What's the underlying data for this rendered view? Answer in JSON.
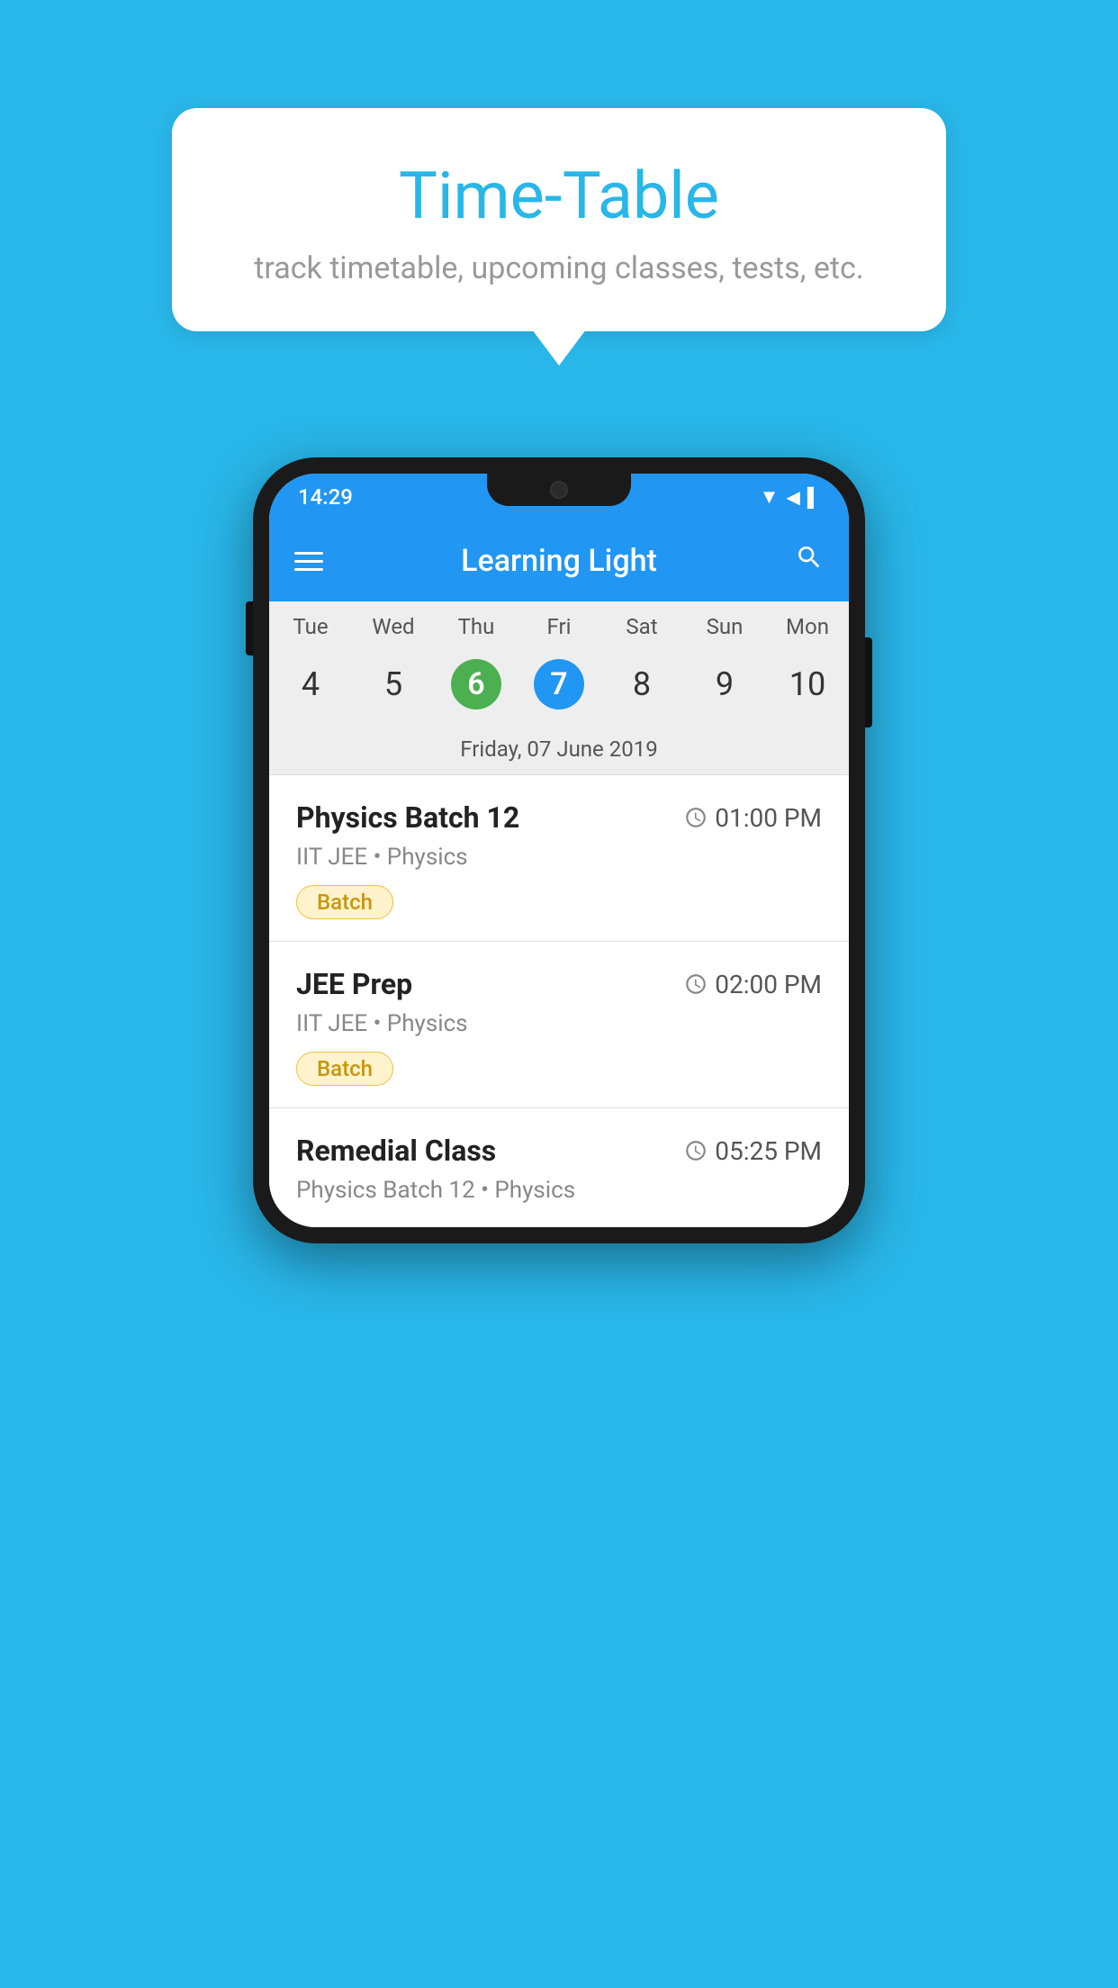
{
  "background_color": "#29b6e8",
  "bubble": {
    "title": "Time-Table",
    "subtitle": "track timetable, upcoming classes, tests, etc."
  },
  "phone": {
    "status_bar": {
      "time": "14:29"
    },
    "app_bar": {
      "title": "Learning Light"
    },
    "calendar": {
      "days": [
        "Tue",
        "Wed",
        "Thu",
        "Fri",
        "Sat",
        "Sun",
        "Mon"
      ],
      "dates": [
        "4",
        "5",
        "6",
        "7",
        "8",
        "9",
        "10"
      ],
      "today_index": 2,
      "selected_index": 3,
      "selected_label": "Friday, 07 June 2019"
    },
    "schedule_items": [
      {
        "title": "Physics Batch 12",
        "time": "01:00 PM",
        "subtitle": "IIT JEE • Physics",
        "badge": "Batch"
      },
      {
        "title": "JEE Prep",
        "time": "02:00 PM",
        "subtitle": "IIT JEE • Physics",
        "badge": "Batch"
      },
      {
        "title": "Remedial Class",
        "time": "05:25 PM",
        "subtitle": "Physics Batch 12 • Physics",
        "badge": null
      }
    ]
  },
  "icons": {
    "hamburger": "☰",
    "search": "🔍",
    "clock": "🕐"
  }
}
